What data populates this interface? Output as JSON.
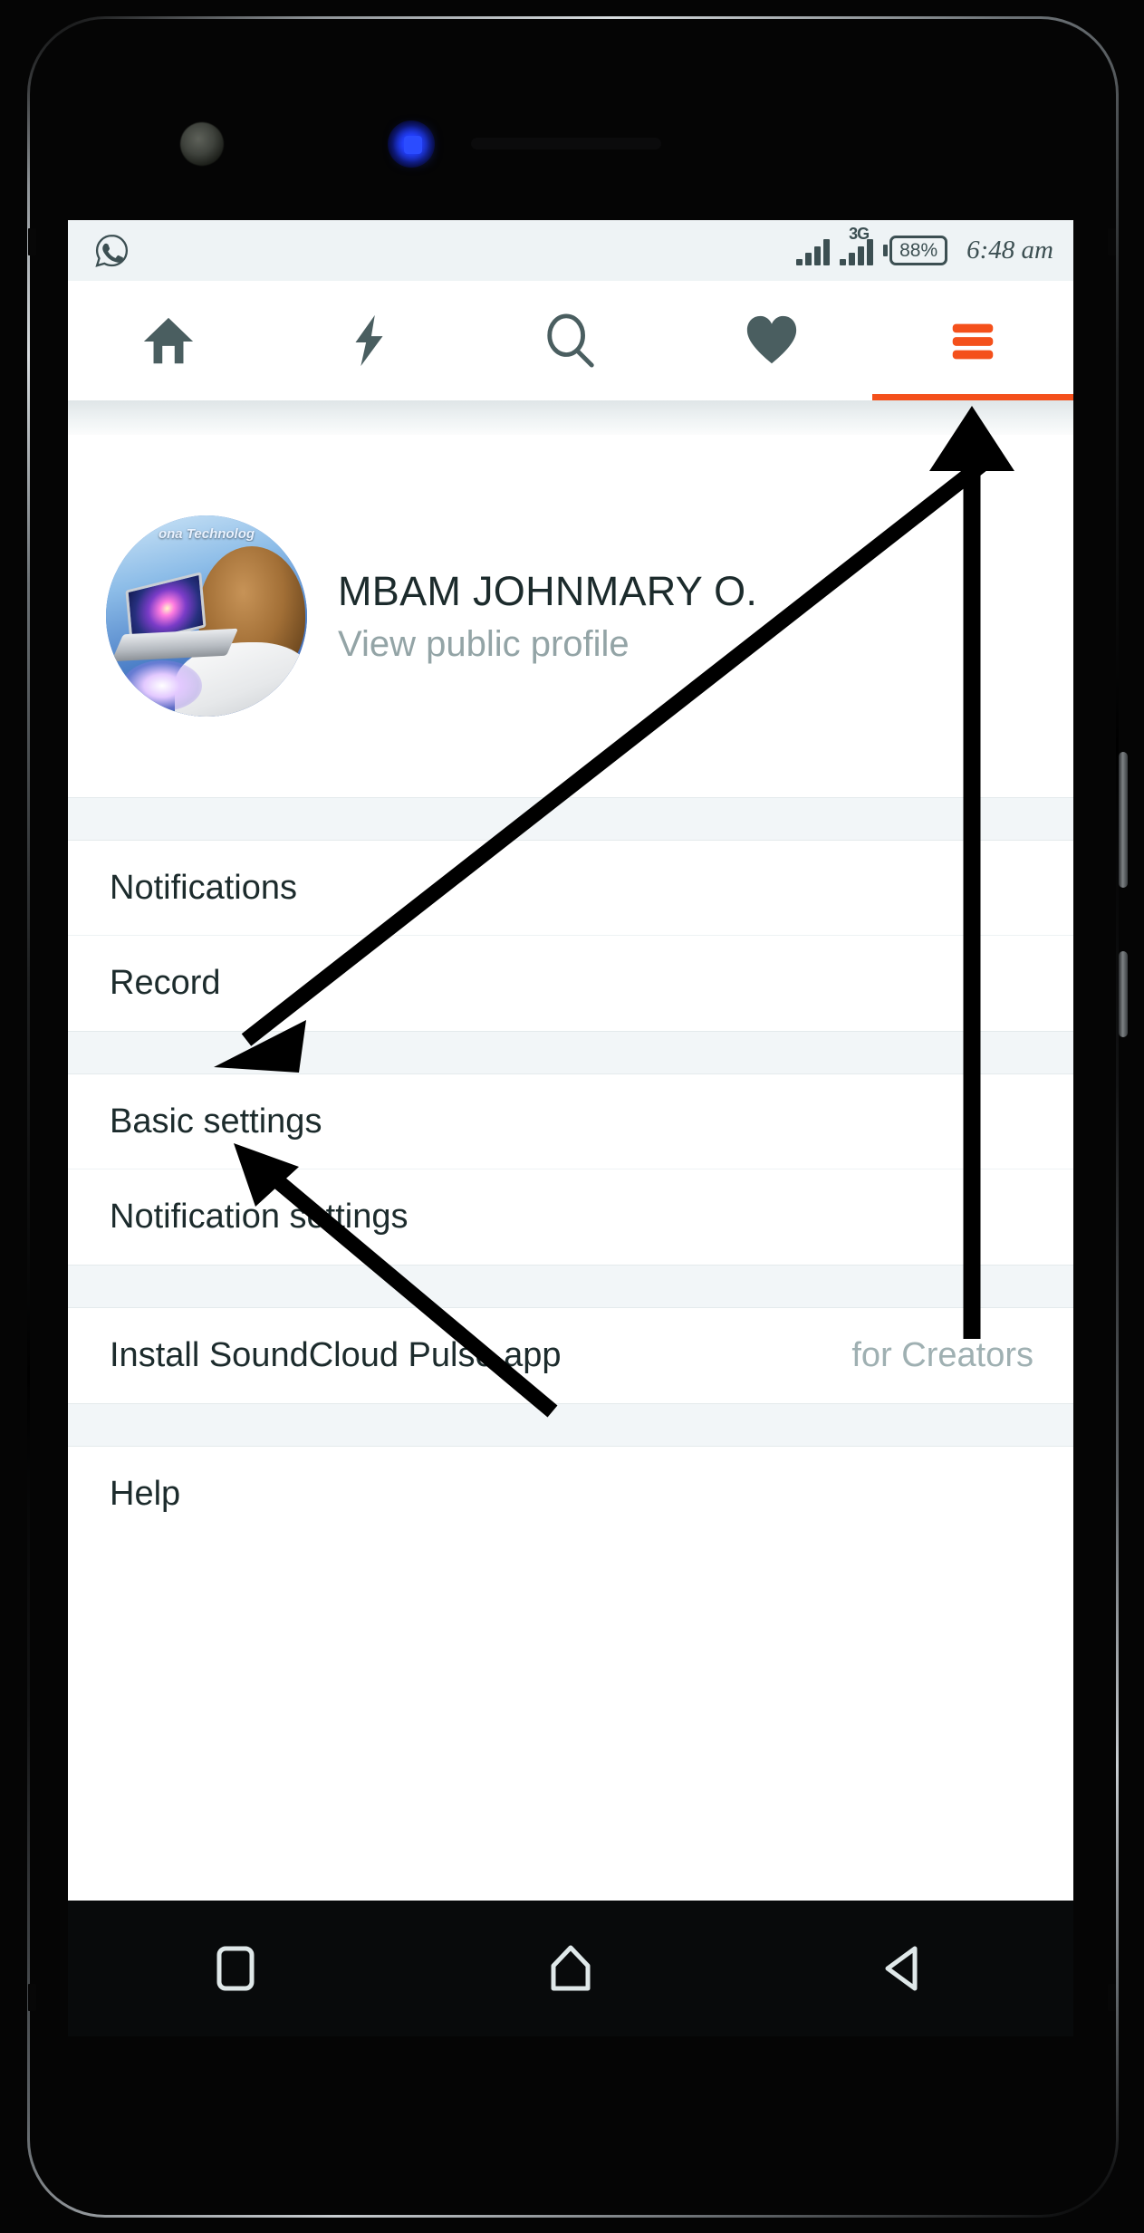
{
  "status_bar": {
    "left_icon": "whatsapp-icon",
    "signal_1_bars": 4,
    "signal_2_bars": 4,
    "network_type": "3G",
    "battery_percent": "88%",
    "time": "6:48 am"
  },
  "top_nav": {
    "items": [
      {
        "icon": "home-icon",
        "label": "Home",
        "active": false
      },
      {
        "icon": "bolt-icon",
        "label": "Stream",
        "active": false
      },
      {
        "icon": "search-icon",
        "label": "Search",
        "active": false
      },
      {
        "icon": "heart-icon",
        "label": "Likes",
        "active": false
      },
      {
        "icon": "hamburger-icon",
        "label": "More",
        "active": true
      }
    ],
    "active_color": "#f4501b",
    "inactive_color": "#4a5e60"
  },
  "profile": {
    "avatar_banner": "ona  Technolog",
    "name": "MBAM JOHNMARY O.",
    "subtitle": "View public profile"
  },
  "menu": {
    "groups": [
      {
        "items": [
          {
            "label": "Notifications",
            "aside": ""
          },
          {
            "label": "Record",
            "aside": ""
          }
        ]
      },
      {
        "items": [
          {
            "label": "Basic settings",
            "aside": ""
          },
          {
            "label": "Notification settings",
            "aside": ""
          }
        ]
      },
      {
        "items": [
          {
            "label": "Install SoundCloud Pulse app",
            "aside": "for Creators"
          }
        ]
      },
      {
        "items": [
          {
            "label": "Help",
            "aside": ""
          }
        ]
      }
    ]
  },
  "android_nav": {
    "items": [
      {
        "icon": "recents-square-icon",
        "label": "Recents"
      },
      {
        "icon": "home-pentagon-icon",
        "label": "Home"
      },
      {
        "icon": "back-triangle-icon",
        "label": "Back"
      }
    ]
  },
  "annotations": [
    {
      "name": "arrow-to-hamburger-menu",
      "target": "hamburger-icon"
    },
    {
      "name": "arrow-to-notifications",
      "target": "Notifications"
    },
    {
      "name": "arrow-to-record",
      "target": "Record"
    }
  ]
}
